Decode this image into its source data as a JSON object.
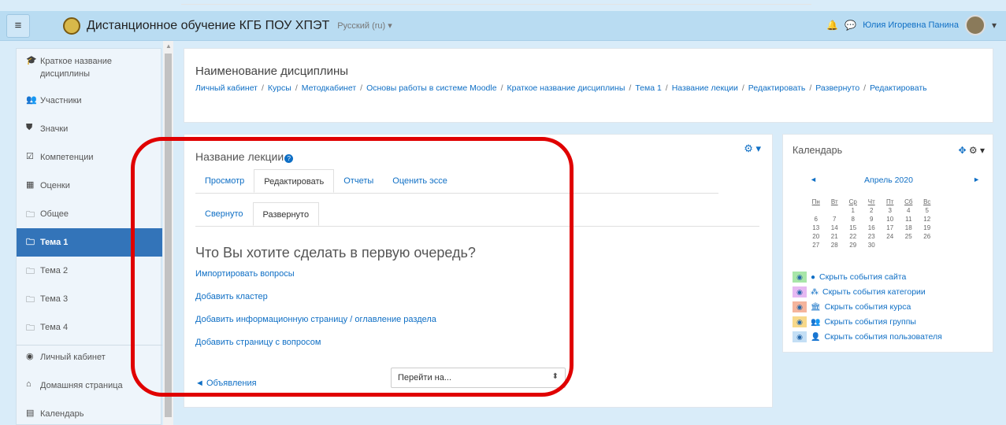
{
  "navbar": {
    "menu_icon": "hamburger-icon",
    "site_name": "Дистанционное обучение КГБ ПОУ ХПЭТ",
    "language": "Русский (ru) ▾",
    "user_name": "Юлия Игоревна Панина",
    "user_menu_caret": "▾"
  },
  "sidebar": {
    "items": [
      {
        "icon": "graduation-cap-icon",
        "glyph": "🎓",
        "label": "Краткое название дисциплины"
      },
      {
        "icon": "users-icon",
        "glyph": "👥",
        "label": "Участники"
      },
      {
        "icon": "shield-icon",
        "glyph": "⛊",
        "label": "Значки"
      },
      {
        "icon": "check-square-icon",
        "glyph": "☑",
        "label": "Компетенции"
      },
      {
        "icon": "table-icon",
        "glyph": "▦",
        "label": "Оценки"
      },
      {
        "icon": "folder-icon",
        "glyph": "🗀",
        "label": "Общее"
      },
      {
        "icon": "folder-icon",
        "glyph": "🗀",
        "label": "Тема 1"
      },
      {
        "icon": "folder-icon",
        "glyph": "🗀",
        "label": "Тема 2"
      },
      {
        "icon": "folder-icon",
        "glyph": "🗀",
        "label": "Тема 3"
      },
      {
        "icon": "folder-icon",
        "glyph": "🗀",
        "label": "Тема 4"
      },
      {
        "icon": "dashboard-icon",
        "glyph": "◉",
        "label": "Личный кабинет"
      },
      {
        "icon": "home-icon",
        "glyph": "⌂",
        "label": "Домашняя страница"
      },
      {
        "icon": "calendar-icon",
        "glyph": "▤",
        "label": "Календарь"
      }
    ],
    "active_index": 6
  },
  "header": {
    "title": "Наименование дисциплины",
    "breadcrumb": [
      "Личный кабинет",
      "Курсы",
      "Методкабинет",
      "Основы работы в системе Moodle",
      "Краткое название дисциплины",
      "Тема 1",
      "Название лекции",
      "Редактировать",
      "Развернуто",
      "Редактировать"
    ],
    "separator": "/"
  },
  "main": {
    "title": "Название лекции",
    "tabs": [
      "Просмотр",
      "Редактировать",
      "Отчеты",
      "Оценить эссе"
    ],
    "active_tab": 1,
    "subtabs": [
      "Свернуто",
      "Развернуто"
    ],
    "active_subtab": 1,
    "question": "Что Вы хотите сделать в первую очередь?",
    "actions": [
      "Импортировать вопросы",
      "Добавить кластер",
      "Добавить информационную страницу / оглавление раздела",
      "Добавить страницу с вопросом"
    ],
    "prev_link": "◄ Объявления",
    "jump_placeholder": "Перейти на...",
    "jump_caret": "⬍"
  },
  "calendar": {
    "title": "Календарь",
    "month": "Апрель 2020",
    "prev": "◄",
    "next": "►",
    "weekdays": [
      "Пн",
      "Вт",
      "Ср",
      "Чт",
      "Пт",
      "Сб",
      "Вс"
    ],
    "weeks": [
      [
        "",
        "",
        "1",
        "2",
        "3",
        "4",
        "5"
      ],
      [
        "6",
        "7",
        "8",
        "9",
        "10",
        "11",
        "12"
      ],
      [
        "13",
        "14",
        "15",
        "16",
        "17",
        "18",
        "19"
      ],
      [
        "20",
        "21",
        "22",
        "23",
        "24",
        "25",
        "26"
      ],
      [
        "27",
        "28",
        "29",
        "30",
        "",
        "",
        ""
      ]
    ],
    "events": [
      {
        "color": "#a8e6a8",
        "icon": "globe-icon",
        "glyph": "●",
        "label": "Скрыть события сайта"
      },
      {
        "color": "#e6b8f2",
        "icon": "cubes-icon",
        "glyph": "⁂",
        "label": "Скрыть события категории"
      },
      {
        "color": "#f5b49c",
        "icon": "university-icon",
        "glyph": "🏛",
        "label": "Скрыть события курса"
      },
      {
        "color": "#f7d98a",
        "icon": "users-icon",
        "glyph": "👥",
        "label": "Скрыть события группы"
      },
      {
        "color": "#c4dff5",
        "icon": "user-icon",
        "glyph": "👤",
        "label": "Скрыть события пользователя"
      }
    ]
  },
  "colors": {
    "accent": "#3374b9",
    "link": "#0f6fc5",
    "highlight": "#e00000"
  }
}
